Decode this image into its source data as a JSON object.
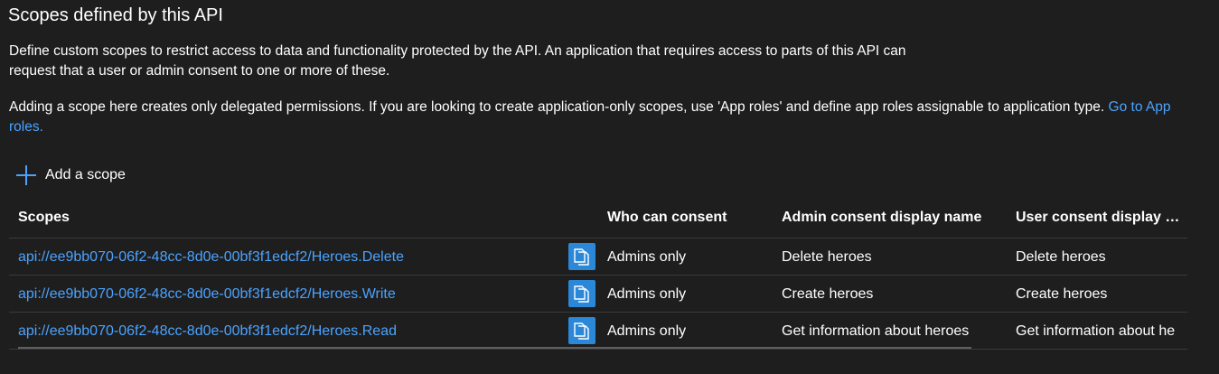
{
  "section": {
    "title": "Scopes defined by this API",
    "description_1": "Define custom scopes to restrict access to data and functionality protected by the API. An application that requires access to parts of this API can request that a user or admin consent to one or more of these.",
    "description_2": "Adding a scope here creates only delegated permissions. If you are looking to create application-only scopes, use 'App roles' and define app roles assignable to application type.",
    "app_roles_link": "Go to App roles."
  },
  "toolbar": {
    "add_scope_label": "Add a scope",
    "add_icon": "plus-icon"
  },
  "table": {
    "headers": {
      "scopes": "Scopes",
      "who_can_consent": "Who can consent",
      "admin_display_name": "Admin consent display name",
      "user_display_name": "User consent display na.."
    },
    "rows": [
      {
        "scope": "api://ee9bb070-06f2-48cc-8d0e-00bf3f1edcf2/Heroes.Delete",
        "who_can_consent": "Admins only",
        "admin_display_name": "Delete heroes",
        "user_display_name": "Delete heroes"
      },
      {
        "scope": "api://ee9bb070-06f2-48cc-8d0e-00bf3f1edcf2/Heroes.Write",
        "who_can_consent": "Admins only",
        "admin_display_name": "Create heroes",
        "user_display_name": "Create heroes"
      },
      {
        "scope": "api://ee9bb070-06f2-48cc-8d0e-00bf3f1edcf2/Heroes.Read",
        "who_can_consent": "Admins only",
        "admin_display_name": "Get information about heroes",
        "user_display_name": "Get information about he"
      }
    ]
  },
  "colors": {
    "background": "#1f1e1e",
    "link": "#4aa3ff",
    "copy_button": "#2b88d8",
    "divider": "#3a3a3a"
  }
}
